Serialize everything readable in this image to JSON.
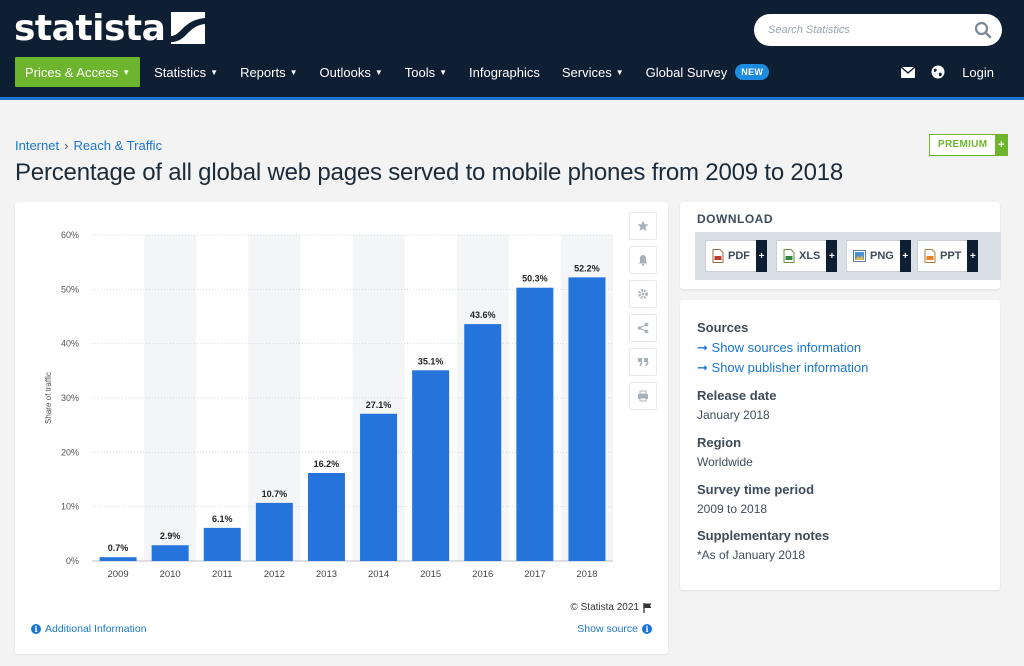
{
  "header": {
    "logo_text": "statista",
    "search_placeholder": "Search Statistics",
    "nav": [
      {
        "label": "Prices & Access",
        "caret": true
      },
      {
        "label": "Statistics",
        "caret": true
      },
      {
        "label": "Reports",
        "caret": true
      },
      {
        "label": "Outlooks",
        "caret": true
      },
      {
        "label": "Tools",
        "caret": true
      },
      {
        "label": "Infographics",
        "caret": false
      },
      {
        "label": "Services",
        "caret": true
      },
      {
        "label": "Global Survey",
        "caret": false
      }
    ],
    "new_badge": "NEW",
    "login": "Login"
  },
  "breadcrumb": [
    "Internet",
    "Reach & Traffic"
  ],
  "premium": "PREMIUM",
  "page_title": "Percentage of all global web pages served to mobile phones from 2009 to 2018",
  "chart_card": {
    "copyright": "© Statista 2021",
    "additional_info": "Additional Information",
    "show_source": "Show source"
  },
  "download": {
    "title": "DOWNLOAD",
    "formats": [
      "PDF",
      "XLS",
      "PNG",
      "PPT"
    ]
  },
  "details": {
    "sources_label": "Sources",
    "show_sources": "Show sources information",
    "show_publisher": "Show publisher information",
    "release_label": "Release date",
    "release_value": "January 2018",
    "region_label": "Region",
    "region_value": "Worldwide",
    "period_label": "Survey time period",
    "period_value": "2009 to 2018",
    "notes_label": "Supplementary notes",
    "notes_value": "*As of January 2018"
  },
  "colors": {
    "bar": "#2574dc",
    "header_bg": "#0f1f33",
    "accent_green": "#6cb52d",
    "link_blue": "#1b75d0"
  },
  "chart_data": {
    "type": "bar",
    "categories": [
      "2009",
      "2010",
      "2011",
      "2012",
      "2013",
      "2014",
      "2015",
      "2016",
      "2017",
      "2018"
    ],
    "values": [
      0.7,
      2.9,
      6.1,
      10.7,
      16.2,
      27.1,
      35.1,
      43.6,
      50.3,
      52.2
    ],
    "value_labels": [
      "0.7%",
      "2.9%",
      "6.1%",
      "10.7%",
      "16.2%",
      "27.1%",
      "35.1%",
      "43.6%",
      "50.3%",
      "52.2%"
    ],
    "ylabel": "Share of traffic",
    "ylim": [
      0,
      60
    ],
    "yticks": [
      0,
      10,
      20,
      30,
      40,
      50,
      60
    ],
    "ytick_labels": [
      "0%",
      "10%",
      "20%",
      "30%",
      "40%",
      "50%",
      "60%"
    ],
    "grid": true
  }
}
